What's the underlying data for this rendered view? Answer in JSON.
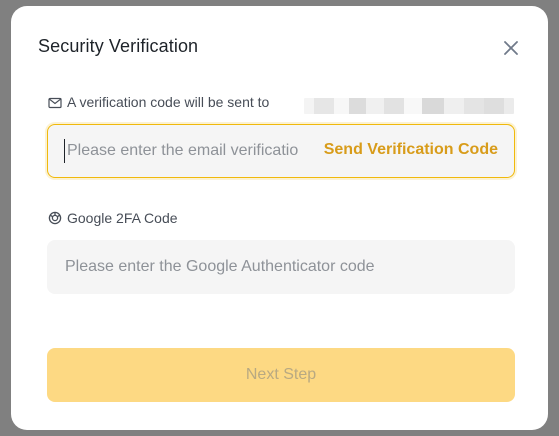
{
  "dialog": {
    "title": "Security Verification",
    "close_icon": "close-icon"
  },
  "email": {
    "icon": "mail-icon",
    "label": "A verification code will be sent to",
    "placeholder": "Please enter the email verification code",
    "value": "",
    "send_code_label": "Send Verification Code"
  },
  "google_2fa": {
    "icon": "google-icon",
    "label": "Google 2FA Code",
    "placeholder": "Please enter the Google Authenticator code",
    "value": ""
  },
  "actions": {
    "next_label": "Next Step",
    "next_disabled": true
  },
  "colors": {
    "accent": "#f0b90b",
    "link": "#d89c1a",
    "button_disabled_bg": "#fdd983",
    "input_bg": "#f5f5f5"
  }
}
